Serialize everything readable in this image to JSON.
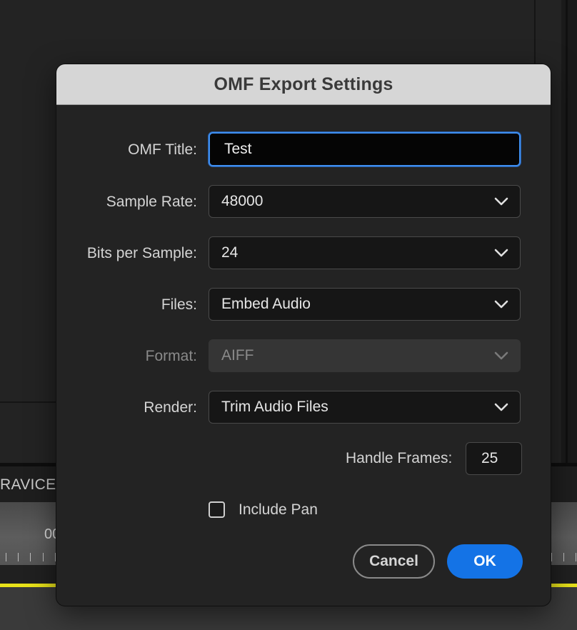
{
  "background": {
    "sequence_label": "RAVICE_",
    "timecode": "00"
  },
  "dialog": {
    "title": "OMF Export Settings",
    "fields": {
      "omf_title": {
        "label": "OMF Title:",
        "value": "Test"
      },
      "sample_rate": {
        "label": "Sample Rate:",
        "value": "48000"
      },
      "bits_per_sample": {
        "label": "Bits per Sample:",
        "value": "24"
      },
      "files": {
        "label": "Files:",
        "value": "Embed Audio"
      },
      "format": {
        "label": "Format:",
        "value": "AIFF",
        "disabled": true
      },
      "render": {
        "label": "Render:",
        "value": "Trim Audio Files"
      },
      "handle_frames": {
        "label": "Handle Frames:",
        "value": "25"
      }
    },
    "include_pan": {
      "label": "Include Pan",
      "checked": false
    },
    "buttons": {
      "cancel": "Cancel",
      "ok": "OK"
    }
  },
  "colors": {
    "accent": "#1473e6",
    "focus_ring": "#3f8ff0",
    "timeline_marker": "#e8e21a"
  },
  "icons": {
    "dropdown": "chevron-down-icon",
    "checkbox": "checkbox-unchecked-icon"
  }
}
